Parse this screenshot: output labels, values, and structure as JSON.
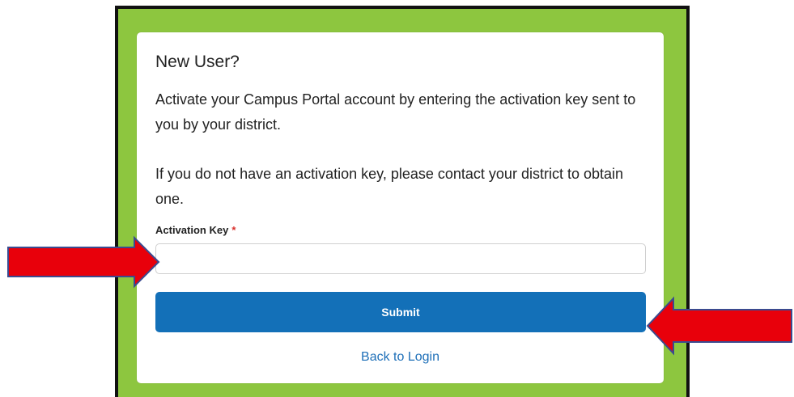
{
  "card": {
    "title": "New User?",
    "paragraph_1": "Activate your Campus Portal account by entering the activation key sent to you by your district.",
    "paragraph_2": "If you do not have an activation key, please contact your district to obtain one."
  },
  "form": {
    "activation_key_label": "Activation Key",
    "required_marker": "*",
    "activation_key_value": "",
    "submit_label": "Submit",
    "back_link_label": "Back to Login"
  },
  "annotations": {
    "arrow_color": "#e8000b",
    "arrow_outline": "#3b4a8f"
  },
  "colors": {
    "frame_background": "#8dc63f",
    "frame_border": "#111111",
    "button_primary": "#1370b8",
    "link": "#1d6fb8",
    "required": "#d9302c"
  }
}
